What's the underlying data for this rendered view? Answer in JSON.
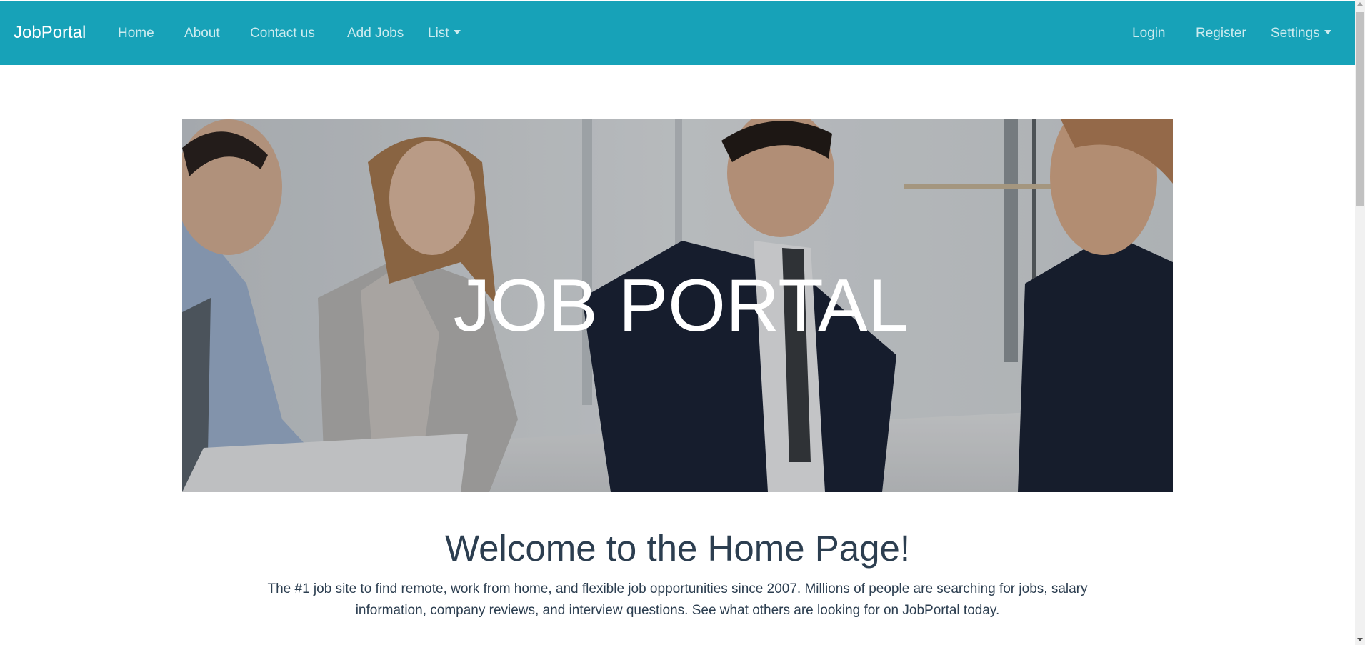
{
  "colors": {
    "navbar_bg": "#17a2b8",
    "heading_text": "#2c3e50",
    "hero_text": "#ffffff"
  },
  "navbar": {
    "brand": "JobPortal",
    "left_links": [
      {
        "label": "Home"
      },
      {
        "label": "About"
      },
      {
        "label": "Contact us"
      },
      {
        "label": "Add Jobs"
      },
      {
        "label": "List",
        "dropdown": true
      }
    ],
    "right_links": [
      {
        "label": "Login"
      },
      {
        "label": "Register"
      },
      {
        "label": "Settings",
        "dropdown": true
      }
    ]
  },
  "hero": {
    "title": "JOB PORTAL",
    "image": "business-people-meeting-photo"
  },
  "welcome": {
    "heading": "Welcome to the Home Page!",
    "text": "The #1 job site to find remote, work from home, and flexible job opportunities since 2007. Millions of people are searching for jobs, salary information, company reviews, and interview questions. See what others are looking for on JobPortal today."
  }
}
